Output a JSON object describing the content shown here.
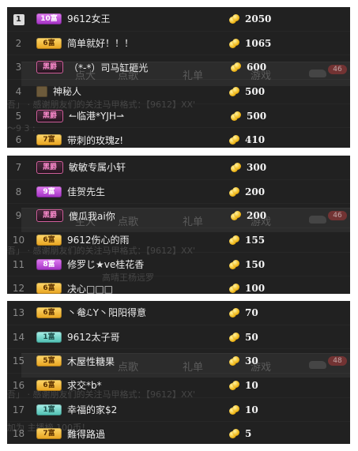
{
  "panels": [
    {
      "ghost": {
        "tabs": [
          "点歌",
          "礼单",
          "游戏"
        ],
        "tab_left": "点大",
        "count": "46",
        "line_1": "吾」  ·  感谢朋友们的关注马甲格式：【9612】XX'",
        "line_2": "～9 3 :"
      },
      "rows": [
        {
          "rank": "1",
          "badge": "10富",
          "badge_style": "purple",
          "name": "9612女王",
          "coins": "2050"
        },
        {
          "rank": "2",
          "badge": "6富",
          "badge_style": "gold",
          "name": "简单就好！！！",
          "coins": "1065"
        },
        {
          "rank": "3",
          "badge": "黑爵",
          "badge_style": "black",
          "name": "（*-*）司马缸砸光",
          "coins": "600"
        },
        {
          "rank": "4",
          "badge": "",
          "badge_style": "mystery",
          "name": "神秘人",
          "coins": "500"
        },
        {
          "rank": "5",
          "badge": "黑爵",
          "badge_style": "black",
          "name": "↼临港*YJH⇀",
          "coins": "500"
        },
        {
          "rank": "6",
          "badge": "7富",
          "badge_style": "gold",
          "name": "带刺的玫瑰z!",
          "coins": "410"
        }
      ]
    },
    {
      "ghost": {
        "tabs": [
          "点歌",
          "礼单",
          "游戏"
        ],
        "tab_left": "主大",
        "count": "46",
        "line_1": "吾」  ·  感谢朋友们的关注马甲格式：【9612】XX'",
        "line_2": "高晴王杨远罗"
      },
      "rows": [
        {
          "rank": "7",
          "badge": "黑爵",
          "badge_style": "black",
          "name": "敏敏专属小轩",
          "coins": "300"
        },
        {
          "rank": "8",
          "badge": "9富",
          "badge_style": "purple",
          "name": "佳贺先生",
          "coins": "200"
        },
        {
          "rank": "9",
          "badge": "黑爵",
          "badge_style": "black",
          "name": "傻瓜我ai你",
          "coins": "200"
        },
        {
          "rank": "10",
          "badge": "6富",
          "badge_style": "gold",
          "name": "9612伤心的雨",
          "coins": "155"
        },
        {
          "rank": "11",
          "badge": "8富",
          "badge_style": "purple",
          "name": "修罗じ★ve桂花香",
          "coins": "150"
        },
        {
          "rank": "12",
          "badge": "6富",
          "badge_style": "gold",
          "name": "决心□□□",
          "coins": "100"
        }
      ]
    },
    {
      "ghost": {
        "tabs": [
          "点歌",
          "礼单",
          "游戏"
        ],
        "tab_left": "",
        "count": "48",
        "line_1": "吾」  ·  感谢朋友们的关注马甲格式：【9612】XX'",
        "line_2": "加为  主播榜 100币！"
      },
      "rows": [
        {
          "rank": "13",
          "badge": "6富",
          "badge_style": "gold",
          "name": "丶奙ℒY丶阳阳得意",
          "coins": "70"
        },
        {
          "rank": "14",
          "badge": "1富",
          "badge_style": "teal",
          "name": "9612太子哥",
          "coins": "50"
        },
        {
          "rank": "15",
          "badge": "5富",
          "badge_style": "gold",
          "name": "木屋性糖果",
          "coins": "30"
        },
        {
          "rank": "16",
          "badge": "6富",
          "badge_style": "gold",
          "name": "求交*b*",
          "coins": "10"
        },
        {
          "rank": "17",
          "badge": "1富",
          "badge_style": "teal",
          "name": "幸福的家$2",
          "coins": "10"
        },
        {
          "rank": "18",
          "badge": "7富",
          "badge_style": "gold",
          "name": "難得路過",
          "coins": "5"
        }
      ]
    }
  ]
}
